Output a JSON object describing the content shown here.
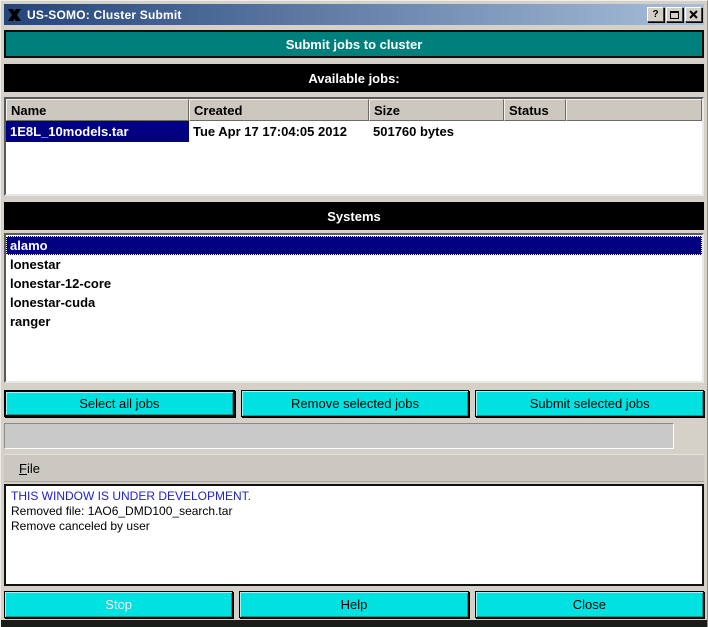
{
  "window": {
    "title": "US-SOMO: Cluster Submit",
    "titlebar_buttons": {
      "help": "?",
      "maximize": "maximize",
      "close": "X"
    }
  },
  "banners": {
    "submit": "Submit jobs to cluster",
    "available_jobs": "Available jobs:",
    "systems": "Systems"
  },
  "jobs_table": {
    "columns": [
      "Name",
      "Created",
      "Size",
      "Status",
      ""
    ],
    "rows": [
      {
        "name": "1E8L_10models.tar",
        "created": "Tue Apr 17 17:04:05 2012",
        "size": "501760 bytes",
        "status": "",
        "selected": true
      }
    ]
  },
  "systems_list": {
    "items": [
      "alamo",
      "lonestar",
      "lonestar-12-core",
      "lonestar-cuda",
      "ranger"
    ],
    "selected_index": 0
  },
  "action_buttons": {
    "select_all": "Select all jobs",
    "remove_selected": "Remove selected jobs",
    "submit_selected": "Submit selected jobs"
  },
  "menu": {
    "items": [
      {
        "label": "File",
        "accel_index": 0
      }
    ]
  },
  "log": {
    "lines": [
      {
        "text": "THIS WINDOW IS UNDER DEVELOPMENT.",
        "color": "#2222cc"
      },
      {
        "text": "Removed file: 1AO6_DMD100_search.tar",
        "color": "#000000"
      },
      {
        "text": "Remove canceled by user",
        "color": "#000000"
      }
    ]
  },
  "footer_buttons": {
    "stop": "Stop",
    "help": "Help",
    "close": "Close"
  },
  "colors": {
    "accent_cyan": "#00e2e2",
    "banner_teal": "#00807d",
    "selection_navy": "#000080",
    "note_blue": "#2222cc",
    "titlebar_gradient_from": "#24457a",
    "titlebar_gradient_to": "#a8bfda"
  }
}
